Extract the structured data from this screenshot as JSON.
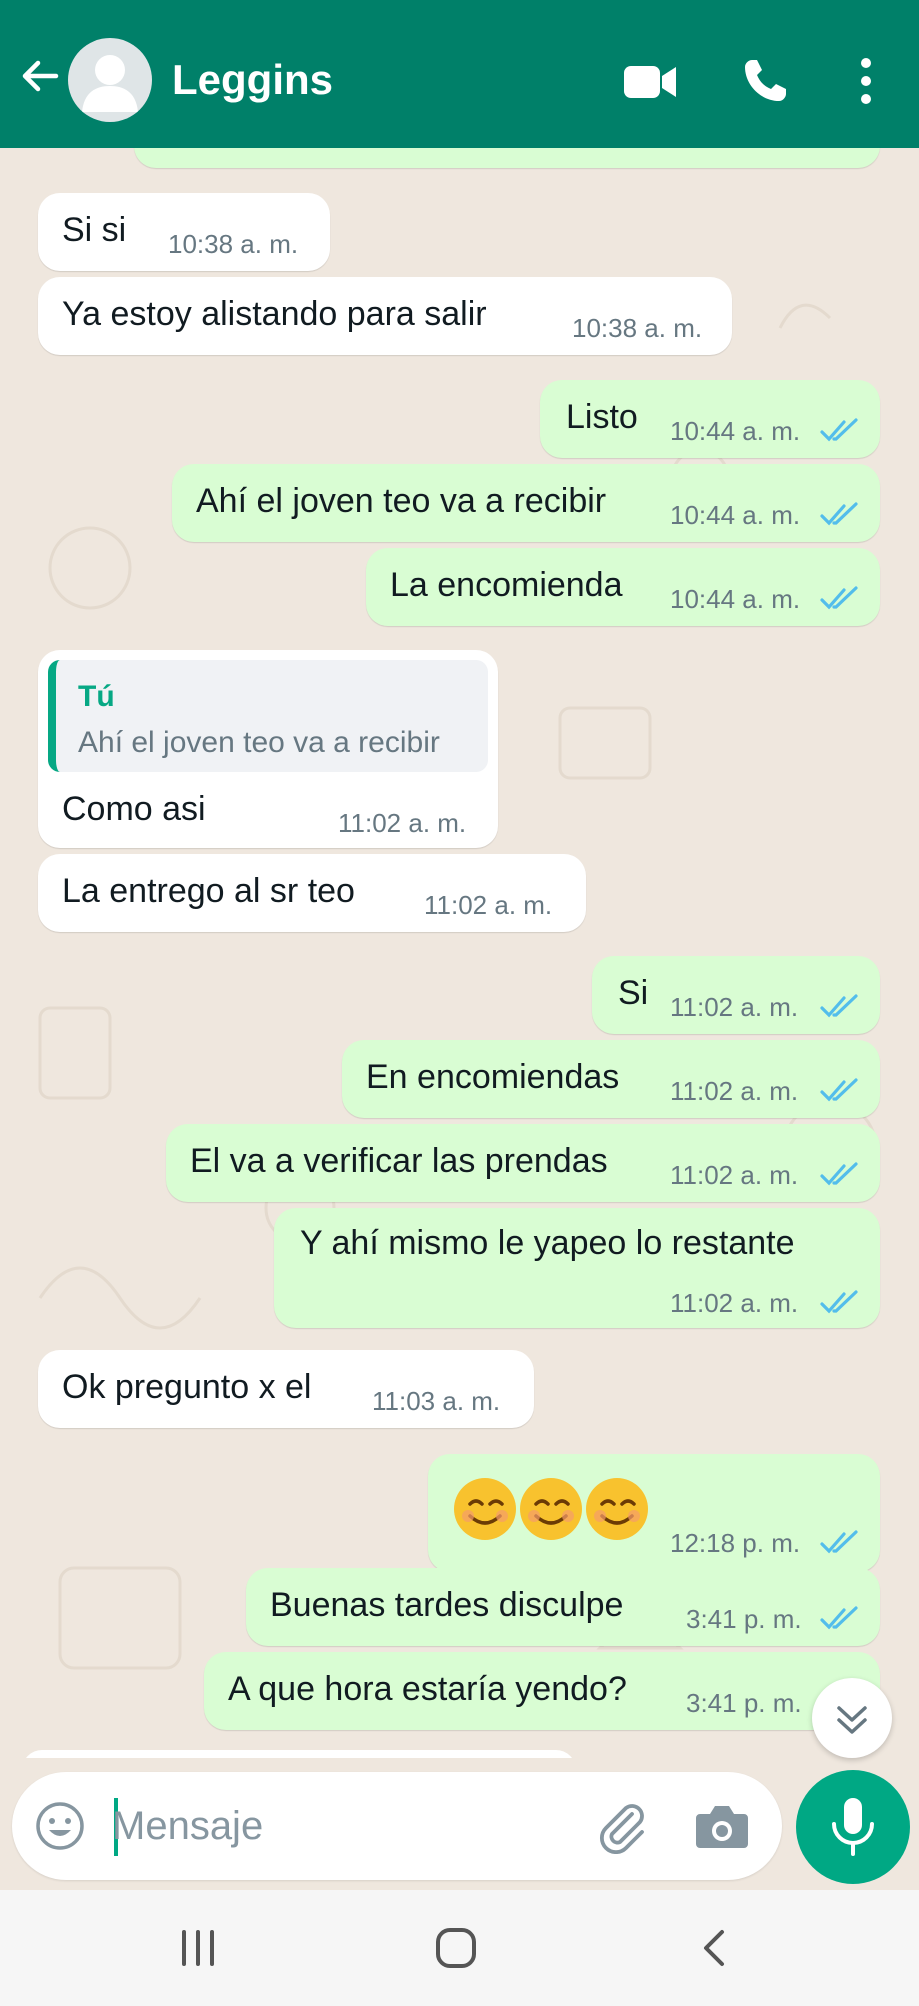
{
  "header": {
    "contact_name": "Leggins",
    "icons": [
      "back-arrow-icon",
      "avatar",
      "video-call-icon",
      "phone-icon",
      "more-options-icon"
    ],
    "color": "#008069"
  },
  "messages": [
    {
      "dir": "in",
      "text": "Si si",
      "time": "10:38 a. m."
    },
    {
      "dir": "in",
      "text": "Ya estoy alistando para salir",
      "time": "10:38 a. m."
    },
    {
      "dir": "out",
      "text": "Listo",
      "time": "10:44 a. m.",
      "read": true
    },
    {
      "dir": "out",
      "text": "Ahí el joven teo va a recibir",
      "time": "10:44 a. m.",
      "read": true
    },
    {
      "dir": "out",
      "text": "La encomienda",
      "time": "10:44 a. m.",
      "read": true
    },
    {
      "dir": "in",
      "quote_author": "Tú",
      "quote_text": "Ahí el joven teo va a recibir",
      "text": "Como asi",
      "time": "11:02 a. m."
    },
    {
      "dir": "in",
      "text": "La entrego al sr teo",
      "time": "11:02 a. m."
    },
    {
      "dir": "out",
      "text": "Si",
      "time": "11:02 a. m.",
      "read": true
    },
    {
      "dir": "out",
      "text": "En encomiendas",
      "time": "11:02 a. m.",
      "read": true
    },
    {
      "dir": "out",
      "text": "El va a verificar las prendas",
      "time": "11:02 a. m.",
      "read": true
    },
    {
      "dir": "out",
      "text": "Y ahí mismo le yapeo lo restante",
      "time": "11:02 a. m.",
      "read": true
    },
    {
      "dir": "in",
      "text": "Ok pregunto x el",
      "time": "11:03 a. m."
    },
    {
      "dir": "out",
      "text": "😊😊😊",
      "time": "12:18 p. m.",
      "read": true,
      "emoji_only": true
    },
    {
      "dir": "out",
      "text": "Buenas tardes disculpe",
      "time": "3:41 p. m.",
      "read": true
    },
    {
      "dir": "out",
      "text": "A que hora estaría yendo?",
      "time": "3:41 p. m.",
      "read": true
    }
  ],
  "composer": {
    "placeholder": "Mensaje",
    "icons": [
      "emoji-icon",
      "attach-icon",
      "camera-icon",
      "mic-icon"
    ],
    "accent": "#00a884"
  },
  "navbar": {
    "icons": [
      "recent-apps-icon",
      "home-icon",
      "back-icon"
    ]
  },
  "colors": {
    "incoming_bubble": "#ffffff",
    "outgoing_bubble": "#d9fdd3",
    "read_ticks": "#53bdeb",
    "background": "#efe7de"
  }
}
